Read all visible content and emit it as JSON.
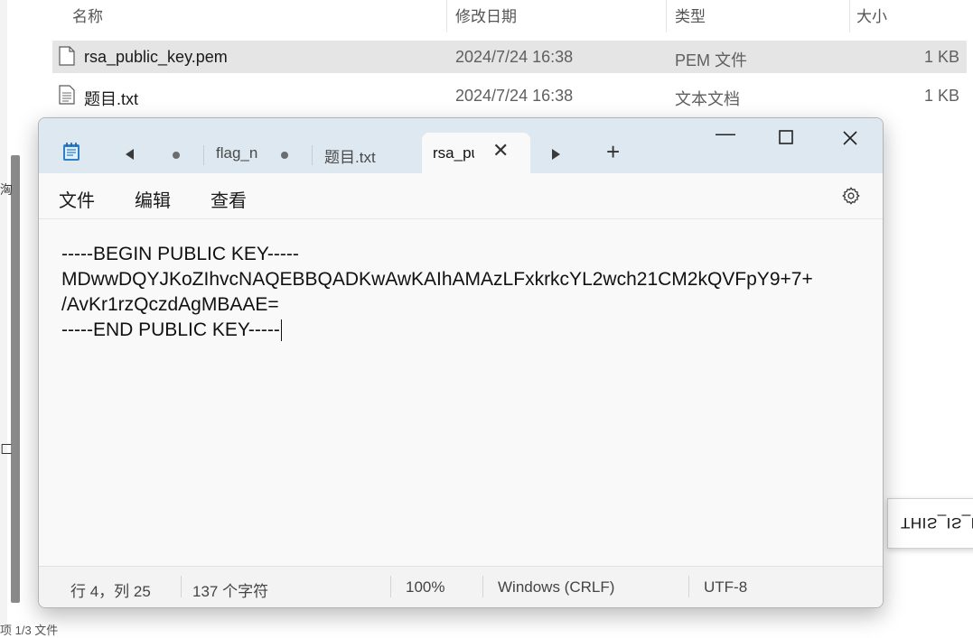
{
  "explorer": {
    "columns": {
      "name": "名称",
      "modified": "修改日期",
      "type": "类型",
      "size": "大小"
    },
    "files": [
      {
        "name": "rsa_public_key.pem",
        "modified": "2024/7/24 16:38",
        "type": "PEM 文件",
        "size": "1 KB",
        "selected": true
      },
      {
        "name": "题目.txt",
        "modified": "2024/7/24 16:38",
        "type": "文本文档",
        "size": "1 KB",
        "selected": false
      }
    ],
    "left_fragments": [
      "洶",
      "匚"
    ],
    "bottom_status_partial": "项  1/3 文件",
    "tooltip_text": "THIS_IS_N"
  },
  "notepad": {
    "tabs": [
      {
        "label": "flag_n",
        "modified": true
      },
      {
        "label": "题目.txt",
        "modified": false
      },
      {
        "label": "rsa_pu",
        "active": true
      }
    ],
    "menu": [
      "文件",
      "编辑",
      "查看"
    ],
    "icons": {
      "app": "notepad-icon",
      "scroll_left": "triangle-left-icon",
      "scroll_right": "triangle-right-icon",
      "new_tab": "plus-icon",
      "close_tab": "close-icon",
      "settings": "gear-icon"
    },
    "window_controls": {
      "minimize": "—",
      "maximize": "☐",
      "close": "✕"
    },
    "content_lines": [
      "-----BEGIN PUBLIC KEY-----",
      "MDwwDQYJKoZIhvcNAQEBBQADKwAwKAIhAMAzLFxkrkcYL2wch21CM2kQVFpY9+7+",
      "/AvKr1rzQczdAgMBAAE=",
      "-----END PUBLIC KEY-----"
    ],
    "status": {
      "position": "行 4，列 25",
      "chars": "137 个字符",
      "zoom": "100%",
      "line_ending": "Windows (CRLF)",
      "encoding": "UTF-8"
    }
  },
  "colors": {
    "titlebar": "#dde8f1",
    "editor_bg": "#f9f9f9",
    "selected_row": "#e5e5e5"
  }
}
